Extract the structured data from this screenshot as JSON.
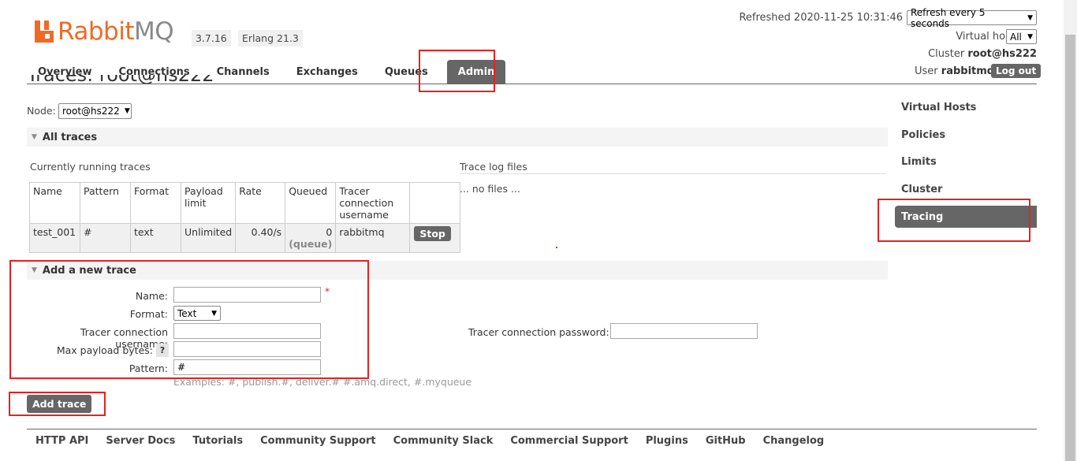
{
  "app": {
    "logo_word_a": "Rabbit",
    "logo_word_b": "MQ",
    "version": "3.7.16",
    "erlang": "Erlang 21.3"
  },
  "header": {
    "refreshed": "Refreshed 2020-11-25 10:31:46",
    "refresh_select": "Refresh every 5 seconds",
    "vhost_label": "Virtual host",
    "vhost_select": "All",
    "cluster_label": "Cluster",
    "cluster_name": "root@hs222",
    "user_label": "User",
    "user_name": "rabbitmq",
    "logout": "Log out"
  },
  "nav": {
    "tabs": [
      "Overview",
      "Connections",
      "Channels",
      "Exchanges",
      "Queues",
      "Admin"
    ],
    "active": "Admin"
  },
  "page": {
    "title": "Traces: root@hs222",
    "node_label": "Node:",
    "node_select": "root@hs222"
  },
  "sidebar": {
    "items": [
      "Virtual Hosts",
      "Policies",
      "Limits",
      "Cluster",
      "Tracing"
    ],
    "active": "Tracing"
  },
  "all_traces": {
    "header": "All traces",
    "running_label": "Currently running traces",
    "log_files_label": "Trace log files",
    "no_files": "... no files ...",
    "columns": [
      "Name",
      "Pattern",
      "Format",
      "Payload limit",
      "Rate",
      "Queued",
      "Tracer connection username"
    ],
    "rows": [
      {
        "name": "test_001",
        "pattern": "#",
        "format": "text",
        "payload_limit": "Unlimited",
        "rate": "0.40/s",
        "queued": "0",
        "queued_sub": "(queue)",
        "tracer_user": "rabbitmq",
        "action": "Stop"
      }
    ]
  },
  "add_trace": {
    "header": "Add a new trace",
    "name_label": "Name:",
    "required_mark": "*",
    "format_label": "Format:",
    "format_value": "Text",
    "user_label": "Tracer connection username:",
    "password_label": "Tracer connection password:",
    "max_payload_label": "Max payload bytes:",
    "help": "?",
    "pattern_label": "Pattern:",
    "pattern_value": "#",
    "examples": "Examples: #, publish.#, deliver.# #.amq.direct, #.myqueue",
    "submit": "Add trace"
  },
  "footer": {
    "links": [
      "HTTP API",
      "Server Docs",
      "Tutorials",
      "Community Support",
      "Community Slack",
      "Commercial Support",
      "Plugins",
      "GitHub",
      "Changelog"
    ]
  },
  "colors": {
    "brand": "#f06a26",
    "active_tab": "#666666",
    "annotation_red": "#e8201f"
  }
}
